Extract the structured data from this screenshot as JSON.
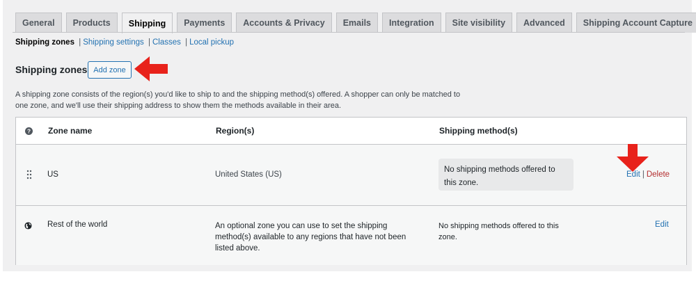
{
  "tabs": [
    {
      "label": "General",
      "active": false
    },
    {
      "label": "Products",
      "active": false
    },
    {
      "label": "Shipping",
      "active": true
    },
    {
      "label": "Payments",
      "active": false
    },
    {
      "label": "Accounts & Privacy",
      "active": false
    },
    {
      "label": "Emails",
      "active": false
    },
    {
      "label": "Integration",
      "active": false
    },
    {
      "label": "Site visibility",
      "active": false
    },
    {
      "label": "Advanced",
      "active": false
    },
    {
      "label": "Shipping Account Capture",
      "active": false
    }
  ],
  "subnav": {
    "current": "Shipping zones",
    "sep": "|",
    "links": [
      "Shipping settings",
      "Classes",
      "Local pickup"
    ]
  },
  "header": {
    "title": "Shipping zones",
    "add_zone_label": "Add zone"
  },
  "description": "A shipping zone consists of the region(s) you'd like to ship to and the shipping method(s) offered. A shopper can only be matched to one zone, and we'll use their shipping address to show them the methods available in their area.",
  "table": {
    "headers": {
      "zone_name": "Zone name",
      "regions": "Region(s)",
      "methods": "Shipping method(s)"
    },
    "rows": [
      {
        "zone": "US",
        "region": "United States (US)",
        "methods": "No shipping methods offered to this zone.",
        "edit_label": "Edit",
        "sep": "|",
        "delete_label": "Delete"
      },
      {
        "zone": "Rest of the world",
        "region": "An optional zone you can use to set the shipping method(s) available to any regions that have not been listed above.",
        "methods": "No shipping methods offered to this zone.",
        "edit_label": "Edit"
      }
    ]
  },
  "colors": {
    "accent": "#2271b1",
    "delete": "#b32d2e",
    "annotation_arrow": "#e8221b",
    "background": "#f0f0f1"
  },
  "icons": {
    "help": "help-icon",
    "drag": "drag-handle-icon",
    "globe": "globe-icon",
    "arrow_left": "annotation-arrow-left-icon",
    "arrow_down": "annotation-arrow-down-icon"
  }
}
